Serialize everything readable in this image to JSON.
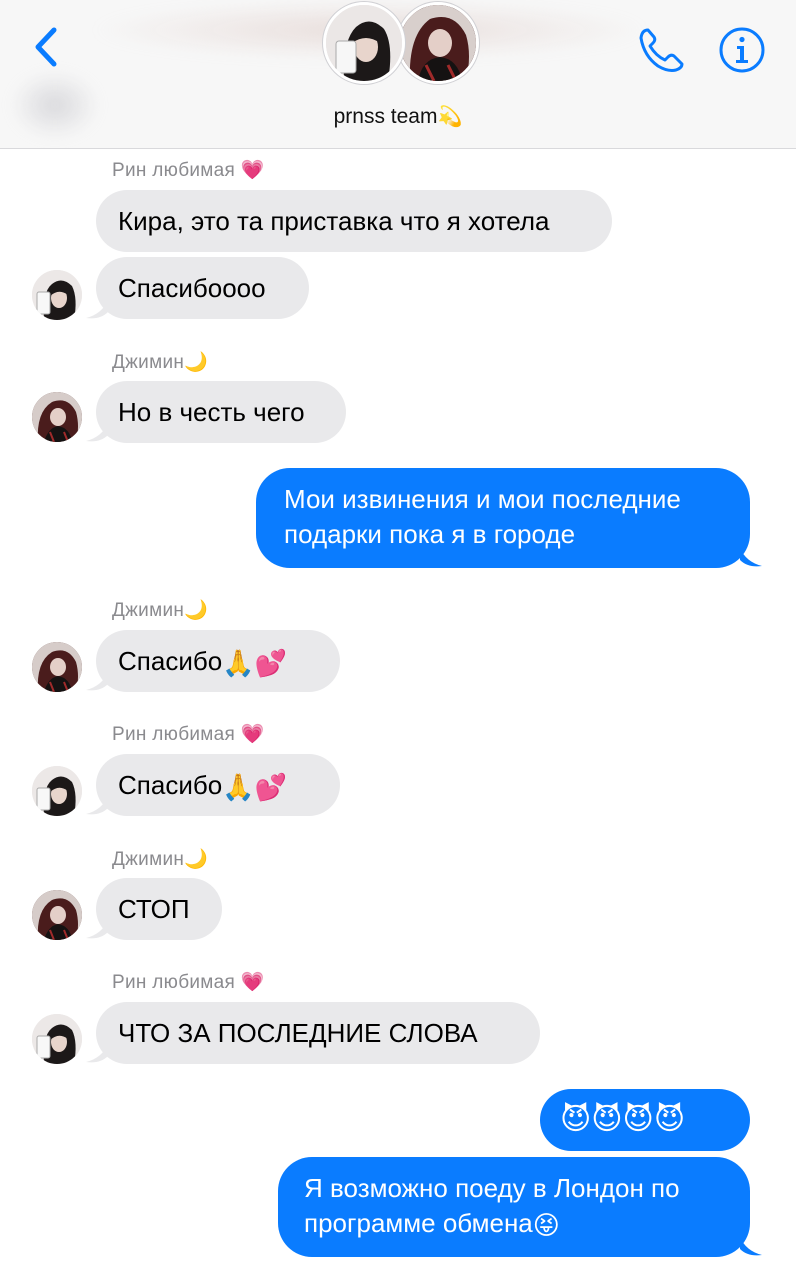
{
  "header": {
    "title": "prnss team",
    "back_icon": "chevron-left-icon",
    "call_icon": "phone-icon",
    "info_icon": "info-icon",
    "accent": "#0a7cff"
  },
  "messages": [
    {
      "sender": "Рин любимая",
      "text": "Кира, это та приставка что я хотела"
    },
    {
      "text": "Спасибоооо"
    },
    {
      "sender": "Джимин",
      "text": "Но в честь чего"
    },
    {
      "text": "Мои извинения и мои последние",
      "text2": "подарки пока я в городе"
    },
    {
      "sender": "Джимин",
      "text": "Спасибо"
    },
    {
      "sender": "Рин любимая",
      "text": "Спасибо"
    },
    {
      "sender": "Джимин",
      "text": "СТОП"
    },
    {
      "sender": "Рин любимая",
      "text": "ЧТО ЗА ПОСЛЕДНИЕ СЛОВА"
    },
    {
      "text": "😈😈😈😈"
    },
    {
      "text": "Я возможно поеду в Лондон по",
      "text2": "программе обмена"
    }
  ],
  "colors": {
    "incoming_bubble": "#e9e9eb",
    "outgoing_bubble": "#0a7cff",
    "sender_label": "#8a8a8e"
  }
}
